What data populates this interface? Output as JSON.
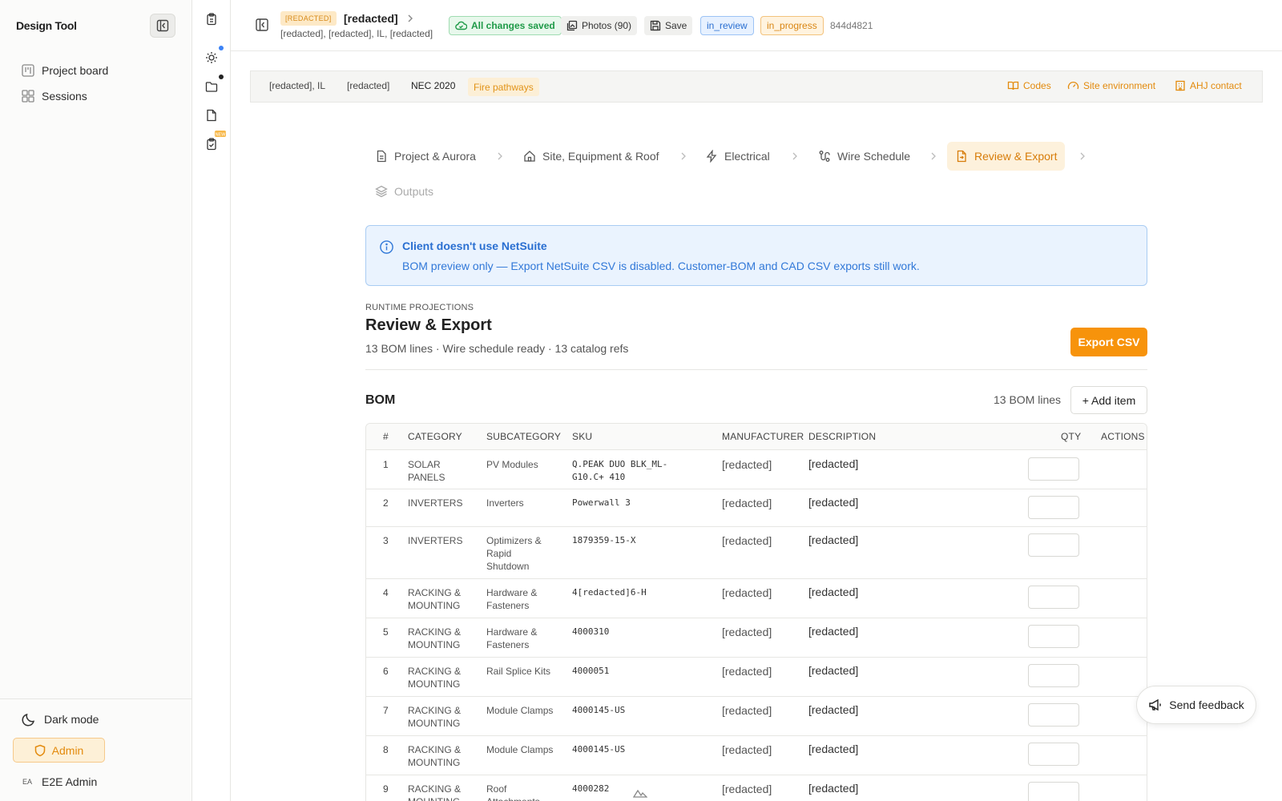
{
  "sidebar": {
    "brand": "Design Tool",
    "nav": [
      {
        "label": "Project board",
        "icon": "kanban-icon"
      },
      {
        "label": "Sessions",
        "icon": "grid-icon"
      }
    ],
    "dark_mode_label": "Dark mode",
    "admin_label": "Admin",
    "user_initials": "EA",
    "user_name": "E2E Admin"
  },
  "header": {
    "tag": "[REDACTED]",
    "title": "[redacted]",
    "subtitle": "[redacted], [redacted], IL, [redacted]",
    "saved_label": "All changes saved",
    "photos_label": "Photos (90)",
    "save_label": "Save",
    "review_status": "in_review",
    "progress_status": "in_progress",
    "id": "844d4821"
  },
  "infobar": {
    "location": "[redacted], IL",
    "jurisdiction": "[redacted]",
    "code": "NEC 2020",
    "fire_tag": "Fire pathways",
    "links": [
      "Codes",
      "Site environment",
      "AHJ contact"
    ]
  },
  "steps": [
    {
      "label": "Project & Aurora",
      "icon": "document-icon",
      "state": "normal"
    },
    {
      "label": "Site, Equipment & Roof",
      "icon": "home-icon",
      "state": "normal"
    },
    {
      "label": "Electrical",
      "icon": "bolt-icon",
      "state": "normal"
    },
    {
      "label": "Wire Schedule",
      "icon": "route-icon",
      "state": "normal"
    },
    {
      "label": "Review & Export",
      "icon": "file-export-icon",
      "state": "active"
    },
    {
      "label": "Outputs",
      "icon": "stack-icon",
      "state": "disabled"
    }
  ],
  "alert": {
    "title": "Client doesn't use NetSuite",
    "text": "BOM preview only — Export NetSuite CSV is disabled. Customer-BOM and CAD CSV exports still work."
  },
  "section": {
    "eyebrow": "RUNTIME PROJECTIONS",
    "title": "Review & Export",
    "meta": "13 BOM lines · Wire schedule ready · 13 catalog refs",
    "export_label": "Export CSV"
  },
  "bom": {
    "title": "BOM",
    "count": "13 BOM lines",
    "add_label": "+ Add item",
    "columns": [
      "#",
      "CATEGORY",
      "SUBCATEGORY",
      "SKU",
      "MANUFACTURER",
      "DESCRIPTION",
      "QTY",
      "ACTIONS"
    ],
    "rows": [
      {
        "num": "1",
        "category": "SOLAR PANELS",
        "subcategory": "PV Modules",
        "sku": "Q.PEAK DUO BLK_ML-G10.C+ 410",
        "manufacturer": "[redacted]",
        "description": "[redacted]"
      },
      {
        "num": "2",
        "category": "INVERTERS",
        "subcategory": "Inverters",
        "sku": "Powerwall 3",
        "manufacturer": "[redacted]",
        "description": "[redacted]"
      },
      {
        "num": "3",
        "category": "INVERTERS",
        "subcategory": "Optimizers & Rapid Shutdown",
        "sku": "1879359-15-X",
        "manufacturer": "[redacted]",
        "description": "[redacted]"
      },
      {
        "num": "4",
        "category": "RACKING & MOUNTING",
        "subcategory": "Hardware & Fasteners",
        "sku": "4[redacted]6-H",
        "manufacturer": "[redacted]",
        "description": "[redacted]"
      },
      {
        "num": "5",
        "category": "RACKING & MOUNTING",
        "subcategory": "Hardware & Fasteners",
        "sku": "4000310",
        "manufacturer": "[redacted]",
        "description": "[redacted]"
      },
      {
        "num": "6",
        "category": "RACKING & MOUNTING",
        "subcategory": "Rail Splice Kits",
        "sku": "4000051",
        "manufacturer": "[redacted]",
        "description": "[redacted]"
      },
      {
        "num": "7",
        "category": "RACKING & MOUNTING",
        "subcategory": "Module Clamps",
        "sku": "4000145-US",
        "manufacturer": "[redacted]",
        "description": "[redacted]"
      },
      {
        "num": "8",
        "category": "RACKING & MOUNTING",
        "subcategory": "Module Clamps",
        "sku": "4000145-US",
        "manufacturer": "[redacted]",
        "description": "[redacted]"
      },
      {
        "num": "9",
        "category": "RACKING & MOUNTING",
        "subcategory": "Roof Attachments",
        "sku": "4000282",
        "manufacturer": "[redacted]",
        "description": "[redacted]"
      }
    ]
  },
  "feedback_label": "Send feedback",
  "colors": {
    "accent": "#f7930b",
    "info": "#2a6fd1",
    "success": "#1f9a48"
  }
}
